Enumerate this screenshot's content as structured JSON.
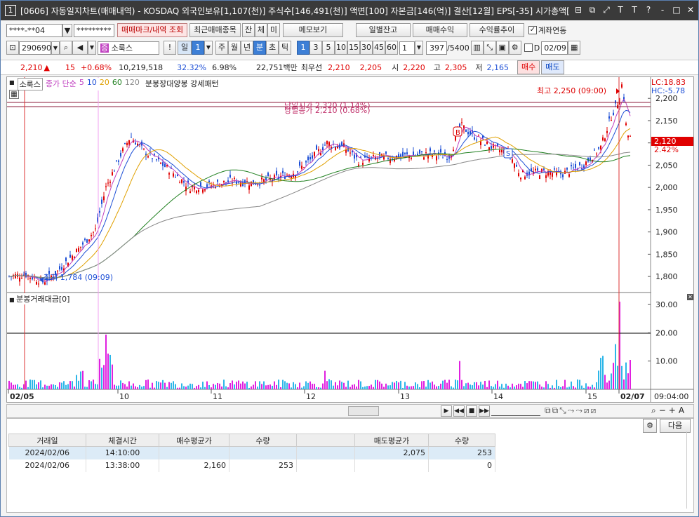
{
  "window": {
    "num": "1",
    "title": "[0606] 자동일지차트(매매내역) - KOSDAQ 외국인보유[1,107(천)] 주식수[146,491(천)] 액면[100] 자본금[146(억)] 결산[12월] EPS[-35] 시가총액[",
    "btns": [
      "⊟",
      "⧉",
      "⤢",
      "T",
      "T",
      "?",
      "‐",
      "□",
      "✕"
    ]
  },
  "toolbar1": {
    "account": "****-**04",
    "dropdown": "▼",
    "password": "*********",
    "trade_mark": "매매마크/내역 조회",
    "recent": "최근매매종목",
    "jan": "잔",
    "che": "체",
    "mi": "미",
    "memo": "메모보기",
    "daily": "일별잔고",
    "profit": "매매수익",
    "yield": "수익률추이",
    "acct_link": "계좌연동"
  },
  "toolbar2": {
    "code": "290690",
    "name": "소룩스",
    "period": [
      "일",
      "1"
    ],
    "period_buttons": [
      "주",
      "월",
      "년",
      "분",
      "초",
      "틱"
    ],
    "nums": [
      "1",
      "3",
      "5",
      "10",
      "15",
      "30",
      "45",
      "60"
    ],
    "count": "1",
    "range": "397",
    "range_total": "/5400",
    "d_label": "D",
    "date": "02/09"
  },
  "quote": {
    "price": "2,210",
    "arrow": "▲",
    "change": "15",
    "pct": "+0.68%",
    "volume": "10,219,518",
    "turnover_rate": "32.32%",
    "rate2": "6.98%",
    "amount": "22,751백만",
    "best_label": "최우선",
    "best_ask": "2,210",
    "best_bid": "2,205",
    "open_label": "시",
    "open": "2,220",
    "high_label": "고",
    "high": "2,305",
    "low_label": "저",
    "low": "2,165",
    "buy": "매수",
    "sell": "매도"
  },
  "legend": {
    "name": "소룩스",
    "ma_label": "종가 단순",
    "ma": [
      "5",
      "10",
      "20",
      "60",
      "120"
    ],
    "pattern": "분봉장대양봉 강세패턴"
  },
  "annotations": {
    "open_text": "당일시가 2,320 (1.14%)",
    "close_text": "당일종가 2,210 (0.68%)",
    "high": "최고 2,250 (09:00)",
    "low": "최저 1,784 (09:09)",
    "lc": "LC:18.83",
    "hc": "HC:-5.78",
    "cur_price": "2,120",
    "cur_pct": "2.42%",
    "B": "B",
    "S": "S"
  },
  "price_axis": [
    "2,200",
    "2,150",
    "2,100",
    "2,050",
    "2,000",
    "1,950",
    "1,900",
    "1,850",
    "1,800"
  ],
  "vol_label": "분봉거래대금[0]",
  "vol_axis": [
    "30.00",
    "20.00",
    "10.00"
  ],
  "x_labels": [
    "02/05",
    "10",
    "11",
    "12",
    "13",
    "14",
    "15",
    "02/07"
  ],
  "time_label": "09:04:00",
  "nav": {
    "next": "다음"
  },
  "trades": {
    "headers": [
      "거래일",
      "체결시간",
      "매수평균가",
      "수량",
      "",
      "매도평균가",
      "수량"
    ],
    "rows": [
      [
        "2024/02/06",
        "14:10:00",
        "",
        "",
        "",
        "2,075",
        "253"
      ],
      [
        "2024/02/06",
        "13:38:00",
        "2,160",
        "253",
        "",
        "",
        "0"
      ]
    ]
  },
  "chart_data": {
    "type": "candlestick",
    "price_range": [
      1775,
      2235
    ],
    "volume_range": [
      0,
      33
    ],
    "price_ticks": [
      2200,
      2150,
      2100,
      2050,
      2000,
      1950,
      1900,
      1850,
      1800
    ],
    "buy_marker": "B",
    "sell_marker": "S"
  }
}
